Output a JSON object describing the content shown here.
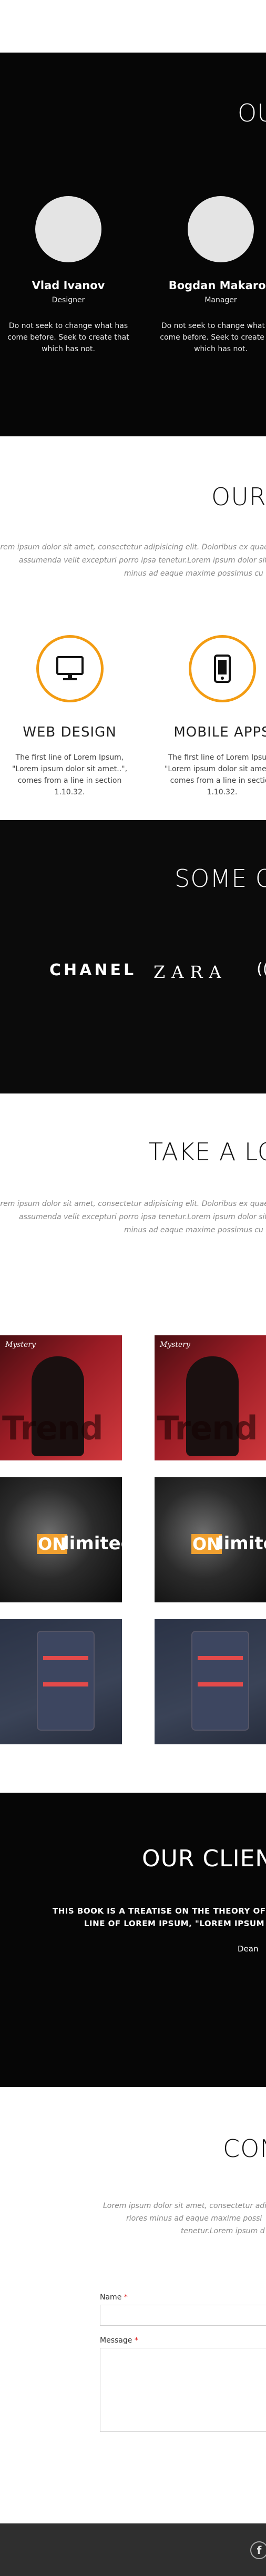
{
  "team": {
    "heading": "OU",
    "members": [
      {
        "name": "Vlad Ivanov",
        "role": "Designer",
        "desc": "Do not seek to change what has come before. Seek to create that which has not."
      },
      {
        "name": "Bogdan Makarov",
        "role": "Manager",
        "desc": "Do not seek to change what has come before. Seek to create that which has not."
      }
    ]
  },
  "services": {
    "heading": "OUR",
    "intro": [
      "Lorem ipsum dolor sit amet, consectetur adipisicing elit. Doloribus ex quaerat",
      "assumenda velit excepturi porro ipsa tenetur.Lorem ipsum dolor sit amet, cor",
      "minus ad eaque maxime possimus cu"
    ],
    "items": [
      {
        "title": "WEB DESIGN",
        "icon": "monitor-icon",
        "desc": "The first line of Lorem Ipsum, \"Lorem ipsum dolor sit amet..\", comes from a line in section 1.10.32."
      },
      {
        "title": "MOBILE APPS",
        "icon": "smartphone-icon",
        "desc": "The first line of Lorem Ipsum, \"Lorem ipsum dolor sit amet..\", comes from a line in section 1.10.32."
      }
    ],
    "accent": "#f39c12"
  },
  "brands": {
    "heading": "SOME OF",
    "logos": [
      "CHANEL",
      "ZARA",
      "(("
    ]
  },
  "portfolio": {
    "heading": "TAKE A LOO",
    "intro": [
      "Lorem ipsum dolor sit amet, consectetur adipisicing elit. Doloribus ex quaerat",
      "assumenda velit excepturi porro ipsa tenetur.Lorem ipsum dolor sit amet, cor",
      "minus ad eaque maxime possimus cu"
    ],
    "items": [
      {
        "caption": "Mystery",
        "overlay": "Trend"
      },
      {
        "caption": "Mystery",
        "overlay": "Trend"
      },
      {
        "caption": "ON",
        "overlay": "limited"
      },
      {
        "caption": "ON",
        "overlay": "limited"
      },
      {
        "caption": "",
        "overlay": ""
      },
      {
        "caption": "",
        "overlay": ""
      }
    ]
  },
  "clients": {
    "heading": "OUR CLIENT",
    "quote": [
      "THIS BOOK IS A TREATISE ON THE THEORY OF E",
      "LINE OF LOREM IPSUM, \"LOREM IPSUM DOL"
    ],
    "author": "Dean"
  },
  "contact": {
    "heading": "CON",
    "intro": [
      "Lorem ipsum dolor sit amet, consectetur adip",
      "riores minus ad eaque maxime possi",
      "tenetur.Lorem ipsum d"
    ],
    "name_label": "Name",
    "message_label": "Message",
    "required_mark": "*"
  },
  "footer": {
    "facebook_letter": "f"
  }
}
